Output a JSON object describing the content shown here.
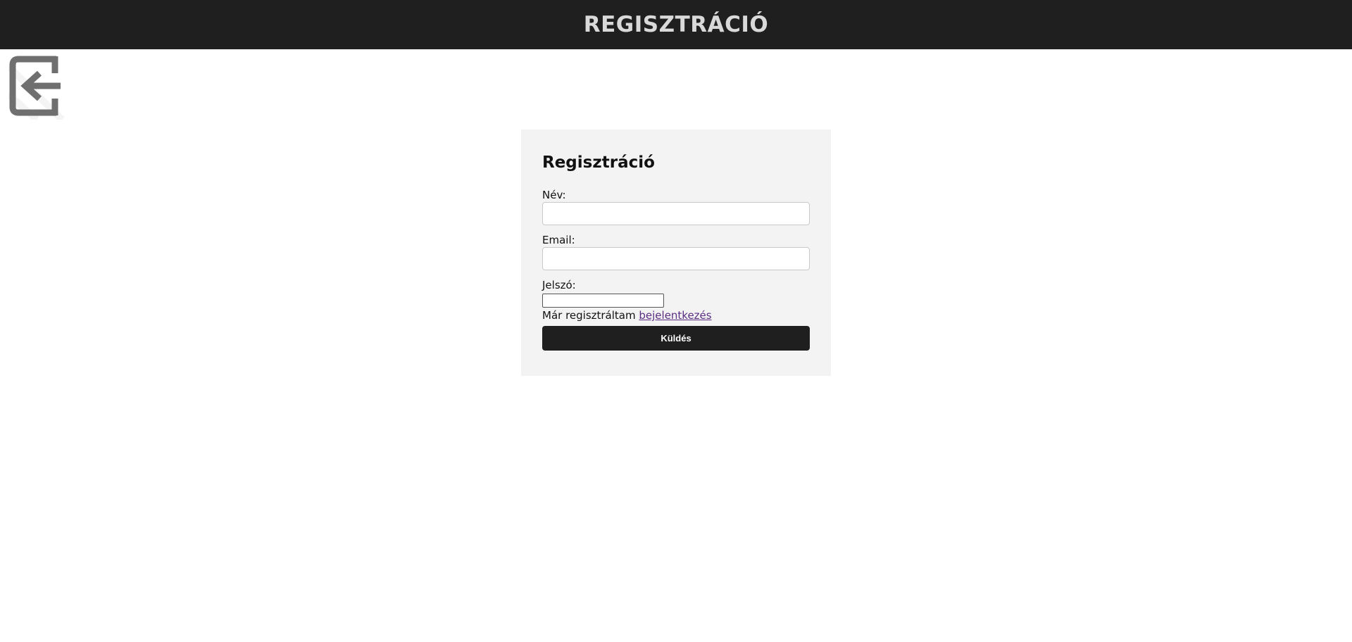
{
  "header": {
    "title": "REGISZTRÁCIÓ"
  },
  "back": {
    "icon": "exit-arrow-left-icon"
  },
  "form": {
    "heading": "Regisztráció",
    "name_label": "Név:",
    "name_value": "",
    "email_label": "Email:",
    "email_value": "",
    "password_label": "Jelszó:",
    "password_value": "",
    "already_text": "Már regisztráltam ",
    "login_link": "bejelentkezés",
    "submit_label": "Küldés"
  },
  "colors": {
    "header_bg": "#1f1f1f",
    "header_text": "#d9d9d9",
    "card_bg": "#f3f3f3",
    "button_bg": "#1f1f1f",
    "link": "#5a2d82",
    "icon": "#6f6f6f"
  }
}
